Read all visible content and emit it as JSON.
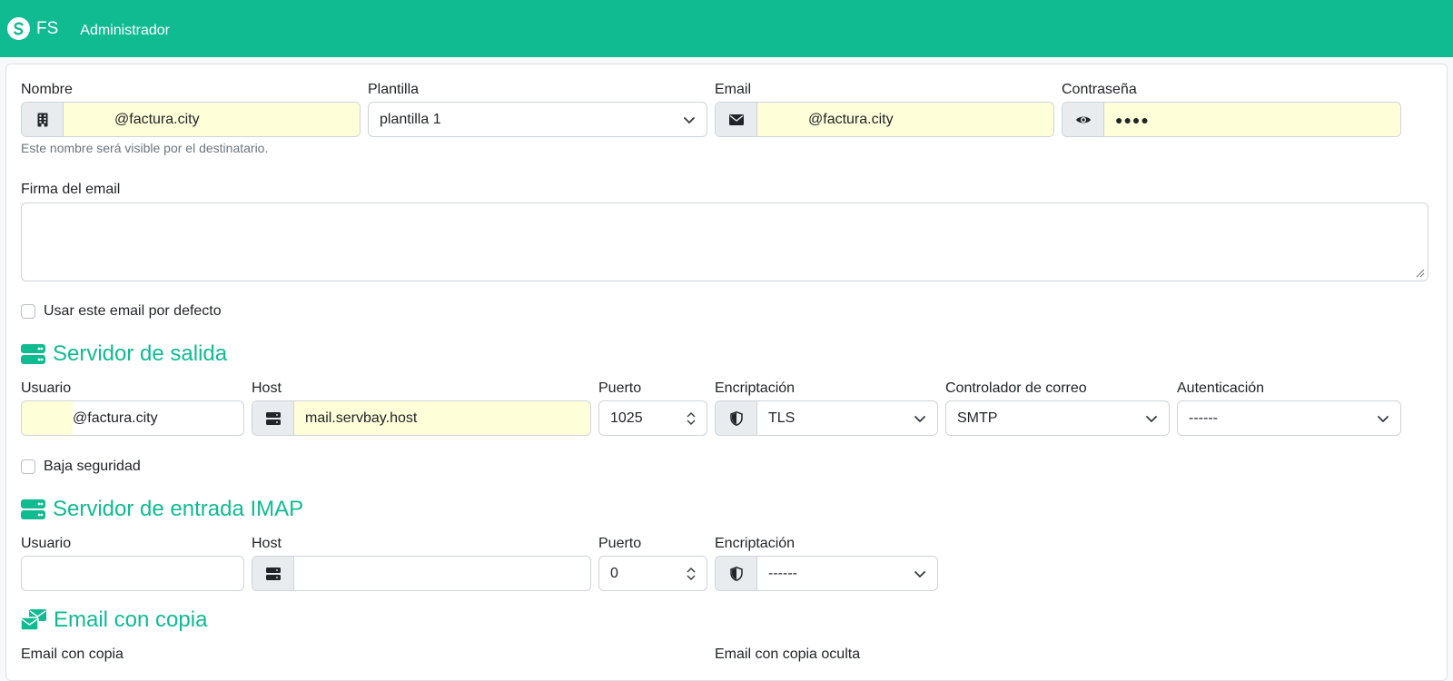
{
  "topbar": {
    "brand": "FS",
    "admin_link": "Administrador",
    "bg_color": "#10bb92"
  },
  "form": {
    "nombre": {
      "label": "Nombre",
      "value": "@factura.city",
      "help": "Este nombre será visible por el destinatario."
    },
    "plantilla": {
      "label": "Plantilla",
      "value": "plantilla 1"
    },
    "email": {
      "label": "Email",
      "value": "@factura.city"
    },
    "password": {
      "label": "Contraseña",
      "value": "●●●●"
    },
    "firma": {
      "label": "Firma del email",
      "value": ""
    },
    "default_checkbox": {
      "label": "Usar este email por defecto",
      "checked": false
    }
  },
  "outgoing": {
    "title": "Servidor de salida",
    "usuario": {
      "label": "Usuario",
      "value": "@factura.city"
    },
    "host": {
      "label": "Host",
      "value": "mail.servbay.host"
    },
    "puerto": {
      "label": "Puerto",
      "value": "1025"
    },
    "encriptacion": {
      "label": "Encriptación",
      "value": "TLS"
    },
    "controlador": {
      "label": "Controlador de correo",
      "value": "SMTP"
    },
    "autenticacion": {
      "label": "Autenticación",
      "value": "------"
    },
    "low_security": {
      "label": "Baja seguridad",
      "checked": false
    }
  },
  "incoming": {
    "title": "Servidor de entrada IMAP",
    "usuario": {
      "label": "Usuario",
      "value": ""
    },
    "host": {
      "label": "Host",
      "value": ""
    },
    "puerto": {
      "label": "Puerto",
      "value": "0"
    },
    "encriptacion": {
      "label": "Encriptación",
      "value": "------"
    }
  },
  "copy": {
    "title": "Email con copia",
    "cc_label": "Email con copia",
    "bcc_label": "Email con copia oculta"
  },
  "icons": [
    "building-icon",
    "mail-icon",
    "eye-icon",
    "server-icon",
    "shield-icon",
    "chevron-down-icon",
    "mailbox-icon"
  ],
  "colors": {
    "accent": "#10bb92",
    "autofill": "#fefed8"
  }
}
